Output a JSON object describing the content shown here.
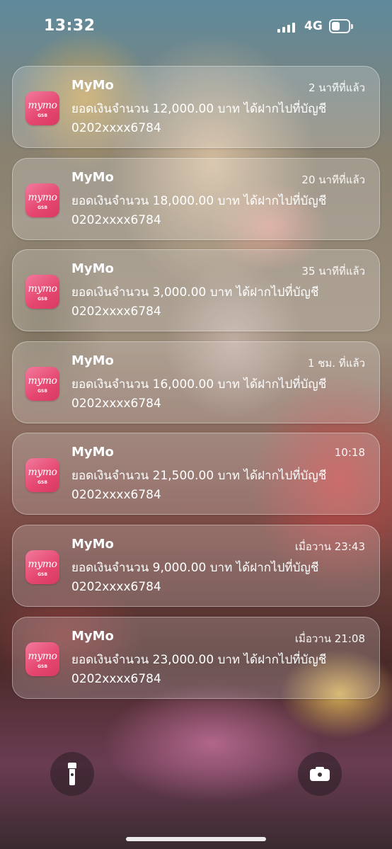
{
  "status_bar": {
    "time": "13:32",
    "network": "4G",
    "signal_icon": "cellular-signal-icon",
    "battery_icon": "battery-icon"
  },
  "notifications": [
    {
      "app": "MyMo",
      "icon_text": "mymo",
      "icon_sub": "GSB",
      "time": "2 นาทีที่แล้ว",
      "line1": "ยอดเงินจำนวน 12,000.00 บาท ได้ฝากไปที่บัญชี",
      "line2": "0202xxxx6784"
    },
    {
      "app": "MyMo",
      "icon_text": "mymo",
      "icon_sub": "GSB",
      "time": "20 นาทีที่แล้ว",
      "line1": "ยอดเงินจำนวน 18,000.00 บาท ได้ฝากไปที่บัญชี",
      "line2": "0202xxxx6784"
    },
    {
      "app": "MyMo",
      "icon_text": "mymo",
      "icon_sub": "GSB",
      "time": "35 นาทีที่แล้ว",
      "line1": "ยอดเงินจำนวน 3,000.00 บาท ได้ฝากไปที่บัญชี",
      "line2": "0202xxxx6784"
    },
    {
      "app": "MyMo",
      "icon_text": "mymo",
      "icon_sub": "GSB",
      "time": "1 ชม. ที่แล้ว",
      "line1": "ยอดเงินจำนวน 16,000.00 บาท ได้ฝากไปที่บัญชี",
      "line2": "0202xxxx6784"
    },
    {
      "app": "MyMo",
      "icon_text": "mymo",
      "icon_sub": "GSB",
      "time": "10:18",
      "line1": "ยอดเงินจำนวน 21,500.00 บาท ได้ฝากไปที่บัญชี",
      "line2": "0202xxxx6784"
    },
    {
      "app": "MyMo",
      "icon_text": "mymo",
      "icon_sub": "GSB",
      "time": "เมื่อวาน 23:43",
      "line1": "ยอดเงินจำนวน 9,000.00 บาท ได้ฝากไปที่บัญชี",
      "line2": "0202xxxx6784"
    },
    {
      "app": "MyMo",
      "icon_text": "mymo",
      "icon_sub": "GSB",
      "time": "เมื่อวาน 21:08",
      "line1": "ยอดเงินจำนวน 23,000.00 บาท ได้ฝากไปที่บัญชี",
      "line2": "0202xxxx6784"
    }
  ],
  "quick_actions": {
    "left_icon": "flashlight-icon",
    "right_icon": "camera-icon"
  },
  "colors": {
    "app_icon_accent": "#e5466f",
    "card_background": "rgba(255,255,255,0.2)",
    "text": "#ffffff"
  }
}
